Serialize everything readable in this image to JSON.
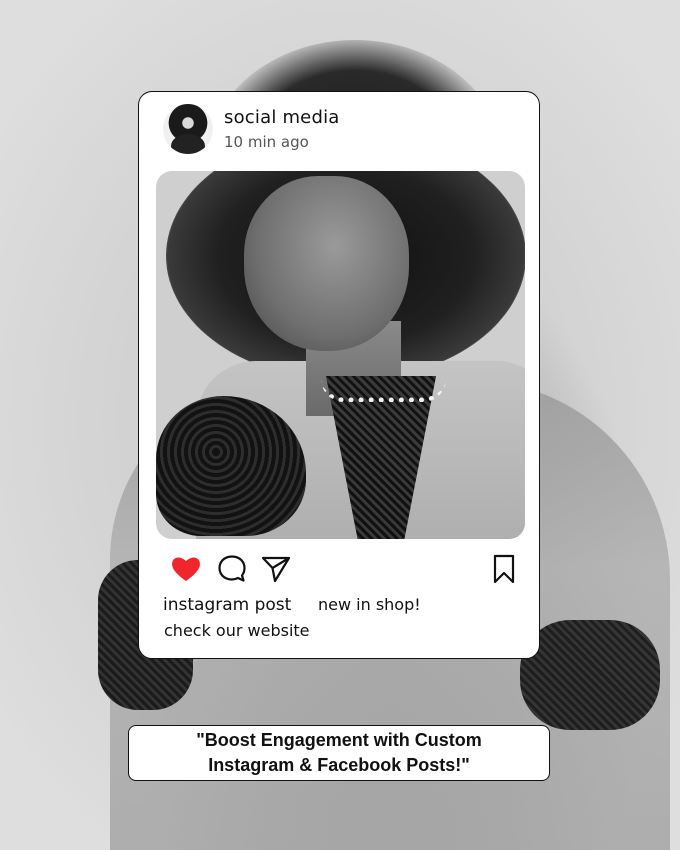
{
  "post": {
    "username": "social media",
    "time": "10 min ago",
    "caption_title": "instagram post",
    "caption_tag": "new in shop!",
    "caption_link": "check our website",
    "liked": true
  },
  "banner": {
    "line1": "\"Boost Engagement with Custom",
    "line2": "Instagram & Facebook Posts!\""
  },
  "icons": {
    "like": "heart-icon",
    "comment": "comment-icon",
    "share": "send-icon",
    "save": "bookmark-icon"
  },
  "colors": {
    "heart": "#f0262c",
    "card": "#ffffff",
    "text": "#111111"
  }
}
